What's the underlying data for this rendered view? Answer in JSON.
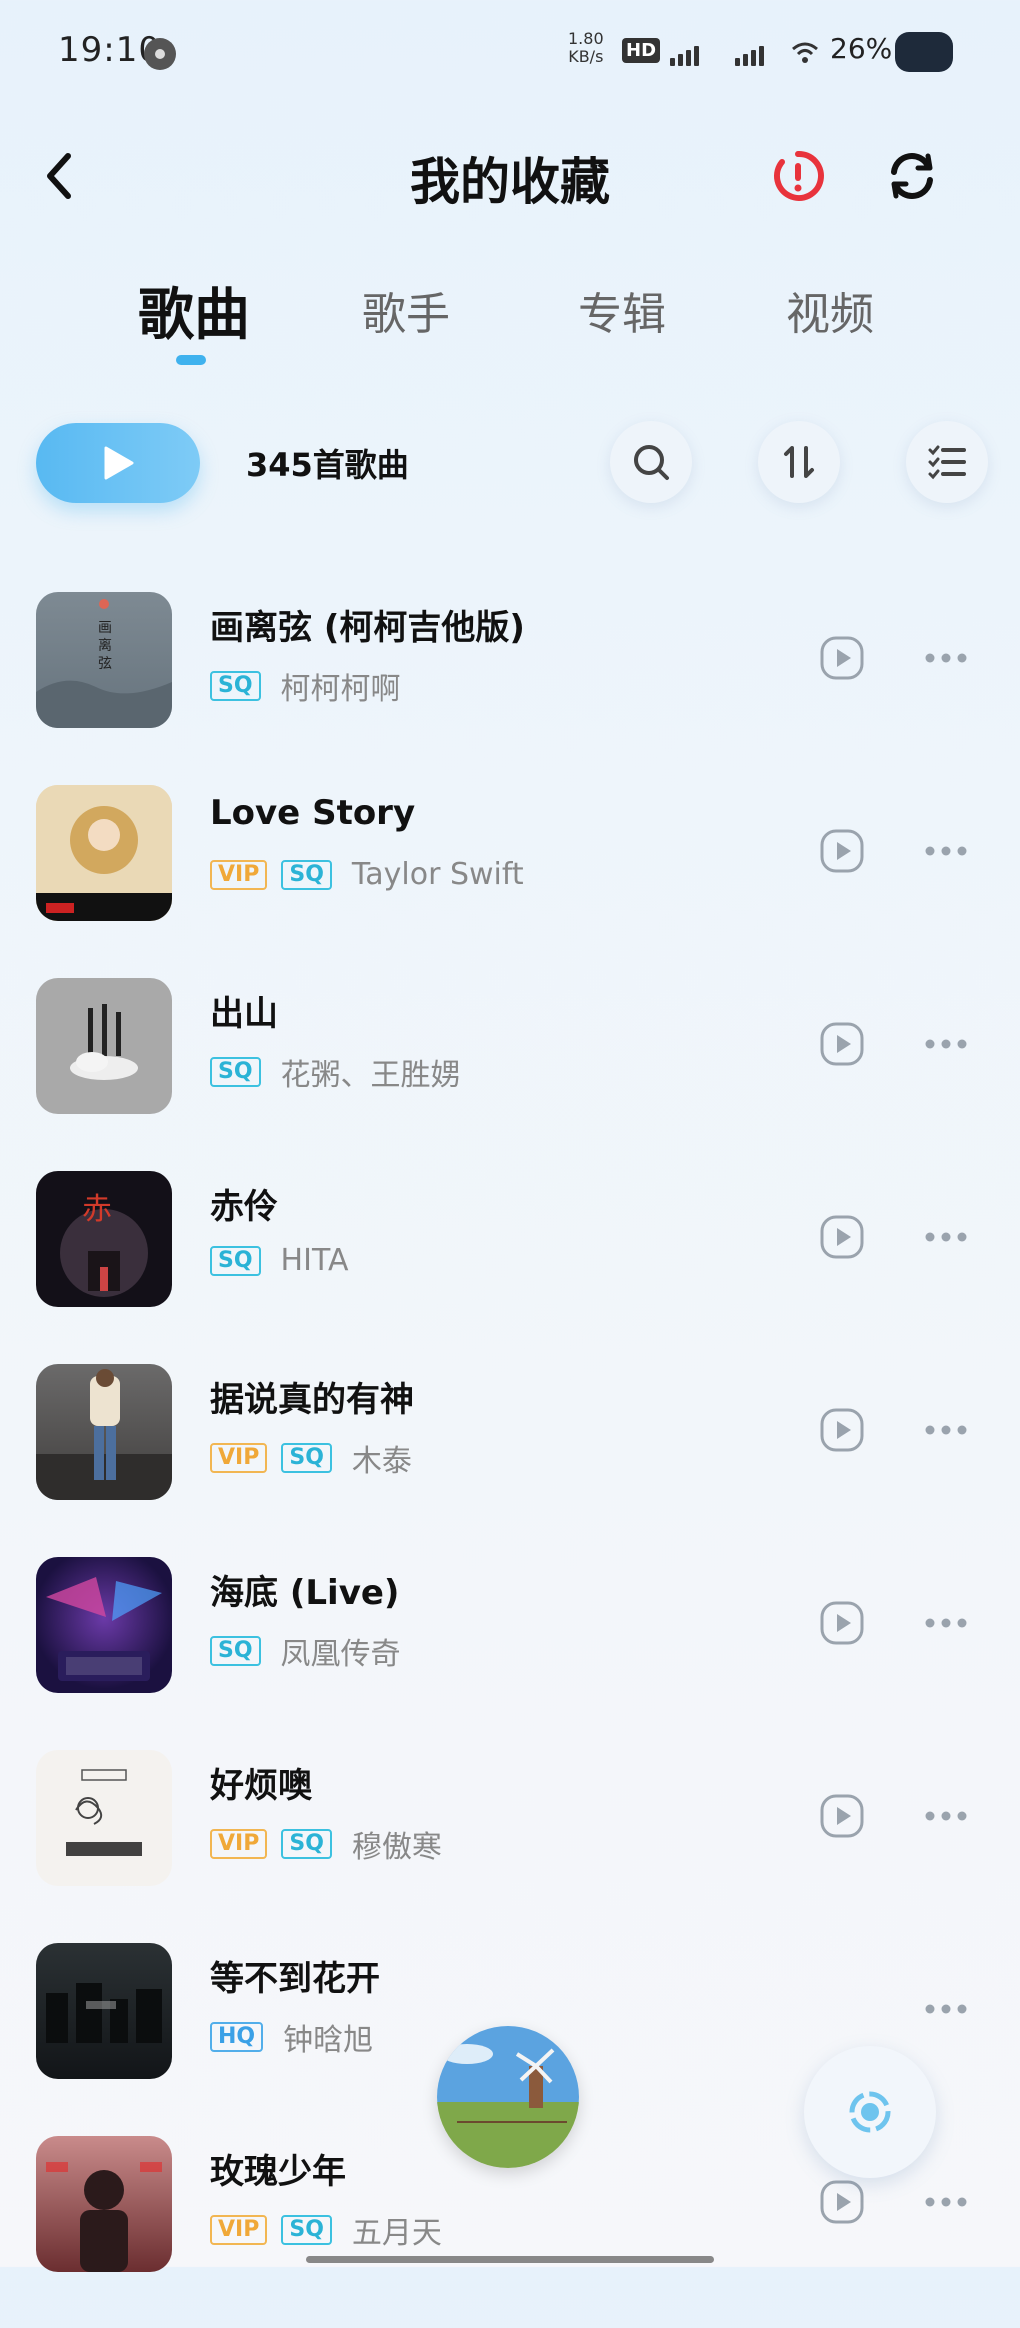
{
  "status_bar": {
    "time": "19:10",
    "net_speed_value": "1.80",
    "net_speed_unit": "KB/s",
    "hd": "HD",
    "battery": "26%"
  },
  "header": {
    "title": "我的收藏"
  },
  "tabs": [
    {
      "label": "歌曲",
      "active": true
    },
    {
      "label": "歌手",
      "active": false
    },
    {
      "label": "专辑",
      "active": false
    },
    {
      "label": "视频",
      "active": false
    }
  ],
  "toolbar": {
    "song_count": "345首歌曲"
  },
  "songs": [
    {
      "title": "画离弦 (柯柯吉他版)",
      "badges": [
        "SQ"
      ],
      "artist": "柯柯柯啊"
    },
    {
      "title": "Love Story",
      "badges": [
        "VIP",
        "SQ"
      ],
      "artist": "Taylor Swift"
    },
    {
      "title": "出山",
      "badges": [
        "SQ"
      ],
      "artist": "花粥、王胜娚"
    },
    {
      "title": "赤伶",
      "badges": [
        "SQ"
      ],
      "artist": "HITA"
    },
    {
      "title": "据说真的有神",
      "badges": [
        "VIP",
        "SQ"
      ],
      "artist": "木泰"
    },
    {
      "title": "海底 (Live)",
      "badges": [
        "SQ"
      ],
      "artist": "凤凰传奇"
    },
    {
      "title": "好烦噢",
      "badges": [
        "VIP",
        "SQ"
      ],
      "artist": "穆傲寒"
    },
    {
      "title": "等不到花开",
      "badges": [
        "HQ"
      ],
      "artist": "钟晗旭"
    },
    {
      "title": "玫瑰少年",
      "badges": [
        "VIP",
        "SQ"
      ],
      "artist": "五月天"
    }
  ],
  "colors": {
    "accent": "#3fb2ee",
    "sq_badge": "#3cc1e0",
    "vip_badge": "#f2b652",
    "alert_red": "#e8333c"
  }
}
